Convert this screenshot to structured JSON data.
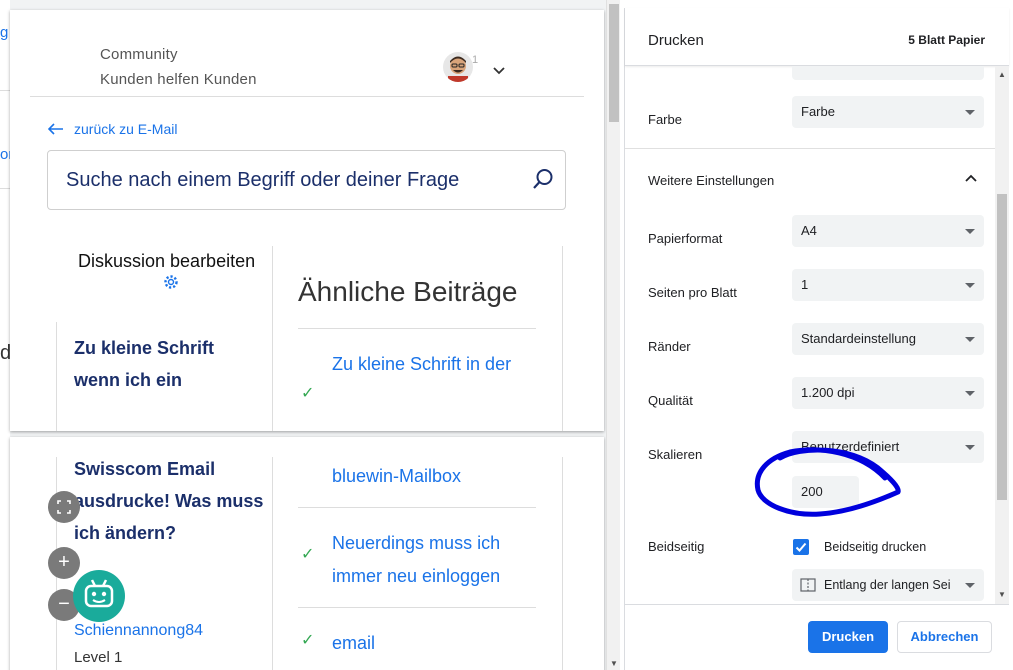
{
  "background": {
    "fragments": [
      "g",
      "or",
      "d"
    ]
  },
  "preview": {
    "community_title": "Community",
    "community_subtitle": "Kunden helfen Kunden",
    "notification_count": "1",
    "back_link": "zurück zu E-Mail",
    "search_placeholder": "Suche nach einem Begriff oder deiner Frage",
    "discussion_edit": "Diskussion bearbeiten",
    "thread_title_line1": "Zu kleine Schrift",
    "thread_title_line2": "wenn ich ein",
    "thread_title_line3": "Swisscom Email",
    "thread_title_line4": "ausdrucke! Was muss",
    "thread_title_line5": "ich ändern?",
    "similar_title": "Ähnliche Beiträge",
    "similar_items": [
      {
        "line1": "Zu kleine Schrift in der",
        "line2": "bluewin-Mailbox"
      },
      {
        "line1": "Neuerdings muss ich",
        "line2": "immer neu einloggen"
      },
      {
        "line1": "email",
        "line2": ""
      }
    ],
    "user_name": "Schiennannong84",
    "user_level": "Level 1",
    "fab_plus": "+",
    "fab_minus": "−"
  },
  "dialog": {
    "title": "Drucken",
    "sheet_count": "5 Blatt Papier",
    "color_label": "Farbe",
    "color_value": "Farbe",
    "more_settings": "Weitere Einstellungen",
    "paper_label": "Papierformat",
    "paper_value": "A4",
    "pages_per_sheet_label": "Seiten pro Blatt",
    "pages_per_sheet_value": "1",
    "margins_label": "Ränder",
    "margins_value": "Standardeinstellung",
    "quality_label": "Qualität",
    "quality_value": "1.200 dpi",
    "scale_label": "Skalieren",
    "scale_value": "Benutzerdefiniert",
    "scale_percent": "200",
    "duplex_label": "Beidseitig",
    "duplex_checkbox": "Beidseitig drucken",
    "duplex_edge": "Entlang der langen Sei",
    "print_button": "Drucken",
    "cancel_button": "Abbrechen"
  },
  "colors": {
    "accent": "#1a73e8",
    "navy": "#1b2f6a",
    "annotation": "#0000dd",
    "bot": "#1aab9b"
  }
}
